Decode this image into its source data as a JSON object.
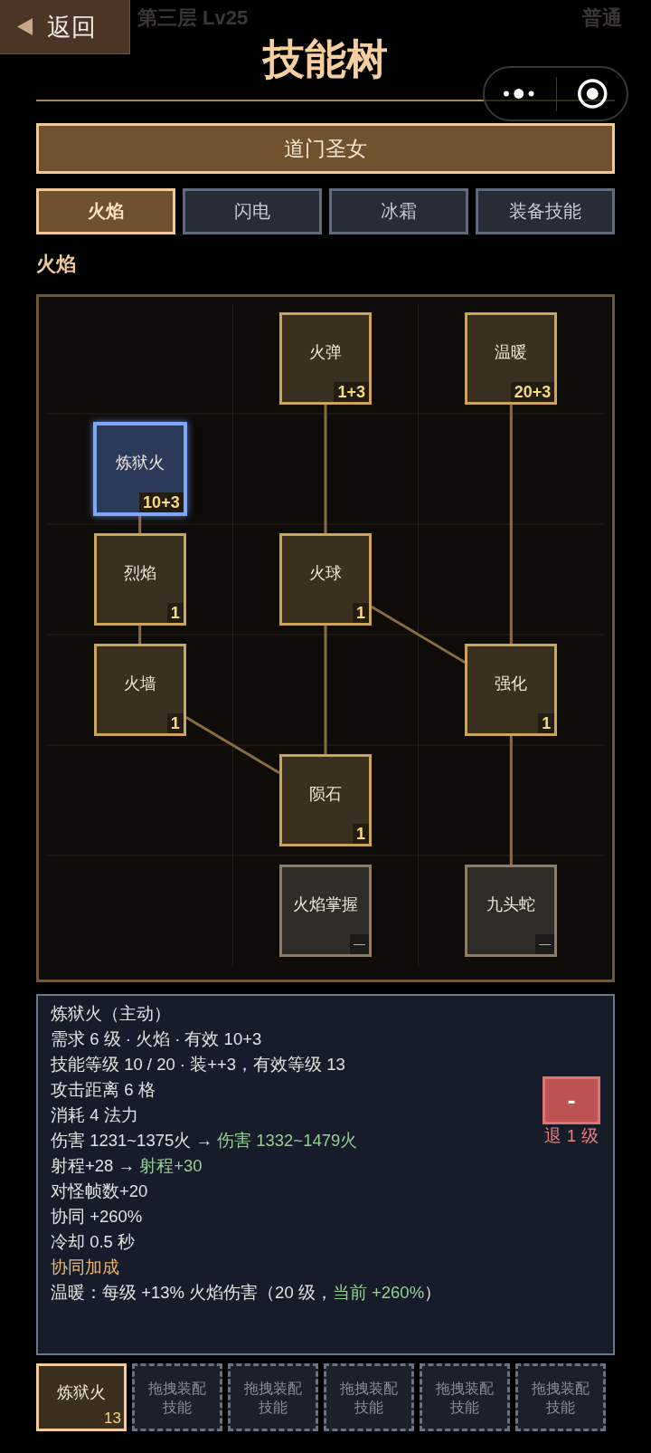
{
  "backdrop": {
    "stage": "第三层 Lv25",
    "mode": "普通"
  },
  "header": {
    "back_label": "返回",
    "title": "技能树"
  },
  "class_banner": "道门圣女",
  "tabs": [
    {
      "label": "火焰",
      "selected": true
    },
    {
      "label": "闪电",
      "selected": false
    },
    {
      "label": "冰霜",
      "selected": false
    },
    {
      "label": "装备技能",
      "selected": false
    }
  ],
  "section_title": "火焰",
  "tree": {
    "rows": [
      [
        null,
        {
          "name": "火弹",
          "rank": "1+3",
          "locked": false,
          "selected": false,
          "link_up": false,
          "link_up_left": false
        },
        {
          "name": "温暖",
          "rank": "20+3",
          "locked": false,
          "selected": false,
          "link_up": false,
          "link_up_left": false
        }
      ],
      [
        {
          "name": "炼狱火",
          "rank": "10+3",
          "locked": false,
          "selected": true,
          "link_up": false,
          "link_up_left": false
        },
        null,
        null
      ],
      [
        {
          "name": "烈焰",
          "rank": "1",
          "locked": false,
          "selected": false,
          "link_up": true,
          "link_up_left": false
        },
        {
          "name": "火球",
          "rank": "1",
          "locked": false,
          "selected": false,
          "link_up": true,
          "link_up_left": false
        },
        null
      ],
      [
        {
          "name": "火墙",
          "rank": "1",
          "locked": false,
          "selected": false,
          "link_up": true,
          "link_up_left": false
        },
        null,
        {
          "name": "强化",
          "rank": "1",
          "locked": false,
          "selected": false,
          "link_up": true,
          "link_up_left": true
        }
      ],
      [
        null,
        {
          "name": "陨石",
          "rank": "1",
          "locked": false,
          "selected": false,
          "link_up": true,
          "link_up_left": true
        },
        null
      ],
      [
        null,
        {
          "name": "火焰掌握",
          "rank": "—",
          "locked": true,
          "selected": false,
          "link_up": false,
          "link_up_left": false
        },
        {
          "name": "九头蛇",
          "rank": "—",
          "locked": true,
          "selected": false,
          "link_up": true,
          "link_up_left": false
        }
      ]
    ]
  },
  "detail": {
    "lines": [
      {
        "segments": [
          {
            "text": "炼狱火（主动）",
            "kind": "plain"
          }
        ]
      },
      {
        "segments": [
          {
            "text": "需求 6 级 · 火焰 · 有效 10+3",
            "kind": "plain"
          }
        ]
      },
      {
        "segments": [
          {
            "text": "技能等级 10 / 20 · 装++3，有效等级 13",
            "kind": "plain"
          }
        ]
      },
      {
        "segments": [
          {
            "text": "攻击距离 6 格",
            "kind": "plain"
          }
        ]
      },
      {
        "segments": [
          {
            "text": "消耗 4 法力",
            "kind": "plain"
          }
        ]
      },
      {
        "segments": [
          {
            "text": "伤害 1231~1375火 → ",
            "kind": "plain"
          },
          {
            "text": "伤害 1332~1479火",
            "kind": "upgrade"
          }
        ]
      },
      {
        "segments": [
          {
            "text": "射程+28 → ",
            "kind": "plain"
          },
          {
            "text": "射程+30",
            "kind": "upgrade"
          }
        ]
      },
      {
        "segments": [
          {
            "text": "对怪帧数+20",
            "kind": "plain"
          }
        ]
      },
      {
        "segments": [
          {
            "text": "协同 +260%",
            "kind": "plain"
          }
        ]
      },
      {
        "segments": [
          {
            "text": "冷却 0.5 秒",
            "kind": "plain"
          }
        ]
      },
      {
        "segments": [
          {
            "text": "协同加成",
            "kind": "heading"
          }
        ]
      },
      {
        "segments": [
          {
            "text": "温暖：每级 +13% 火焰伤害（20 级，",
            "kind": "plain"
          },
          {
            "text": "当前 +260%",
            "kind": "upgrade"
          },
          {
            "text": "）",
            "kind": "plain"
          }
        ]
      }
    ],
    "downgrade": {
      "symbol": "-",
      "caption": "退 1 级"
    }
  },
  "slots": [
    {
      "kind": "skill",
      "label": "炼狱火",
      "rank": "13"
    },
    {
      "kind": "empty",
      "label": "拖拽装配技能"
    },
    {
      "kind": "empty",
      "label": "拖拽装配技能"
    },
    {
      "kind": "empty",
      "label": "拖拽装配技能"
    },
    {
      "kind": "empty",
      "label": "拖拽装配技能"
    },
    {
      "kind": "empty",
      "label": "拖拽装配技能"
    }
  ]
}
